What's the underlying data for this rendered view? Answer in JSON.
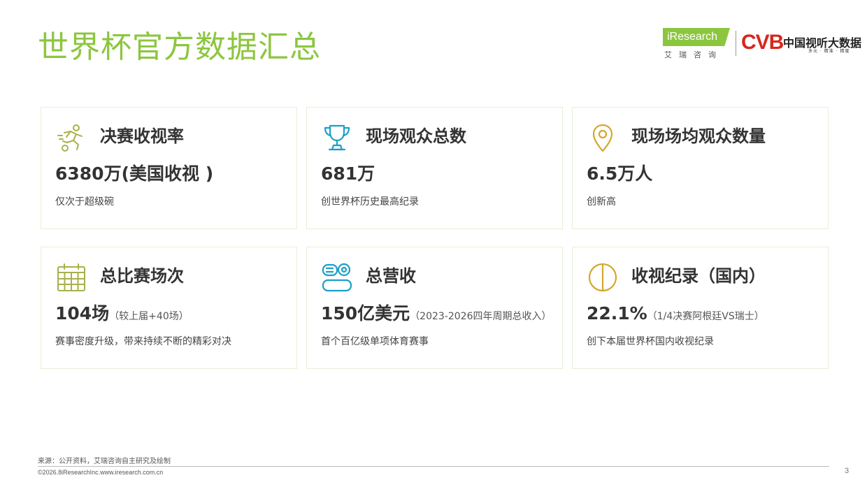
{
  "header": {
    "title": "世界杯官方数据汇总",
    "logo_iresearch": "iResearch",
    "logo_iresearch_cn": "艾瑞咨询",
    "logo_cvb": "CVB",
    "logo_cvb_name": "中国视听大数据",
    "logo_cvb_sub": "多元 · 精准 · 精度"
  },
  "cards": [
    {
      "title": "决赛收视率",
      "value": "6380万(美国收视 )",
      "note": "",
      "desc": "仅次于超级碗",
      "icon": "soccer-player-icon"
    },
    {
      "title": "现场观众总数",
      "value": "681万",
      "note": "",
      "desc": "创世界杯历史最高纪录",
      "icon": "trophy-icon"
    },
    {
      "title": "现场场均观众数量",
      "value": "6.5万人",
      "note": "",
      "desc": "创新高",
      "icon": "location-pin-icon"
    },
    {
      "title": "总比赛场次",
      "value": "104场",
      "note": "（较上届+40场）",
      "desc": "赛事密度升级，带来持续不断的精彩对决",
      "icon": "calendar-icon"
    },
    {
      "title": "总营收",
      "value": "150亿美元",
      "note": "（2023-2026四年周期总收入）",
      "desc": "首个百亿级单项体育赛事",
      "icon": "revenue-icon"
    },
    {
      "title": "收视纪录（国内）",
      "value": "22.1%",
      "note": "（1/4决赛阿根廷VS瑞士）",
      "desc": "创下本届世界杯国内收视纪录",
      "icon": "half-circle-icon"
    }
  ],
  "colors": {
    "accent": "#8cc63f",
    "icon_teal": "#1aa0c8",
    "icon_olive": "#a8b04a",
    "icon_gold": "#d4a72c"
  },
  "footer": {
    "source": "来源：公开资料，艾瑞咨询自主研究及绘制",
    "copyright": "©2026.8iResearchInc.www.iresearch.com.cn",
    "page": "3"
  }
}
